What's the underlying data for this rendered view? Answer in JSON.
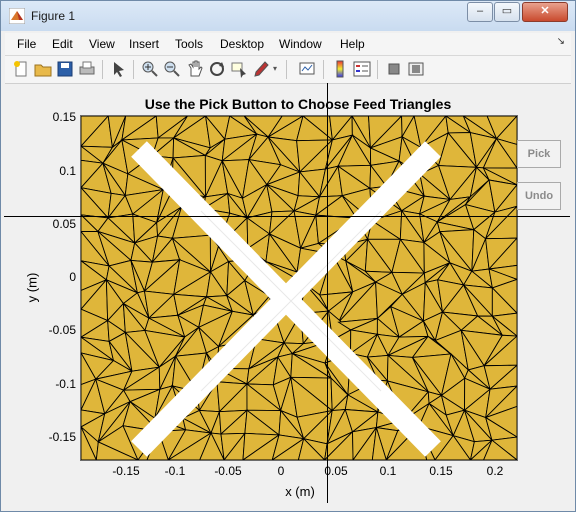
{
  "window": {
    "title": "Figure 1",
    "minimize": "–",
    "maximize": "▭",
    "close": "✕"
  },
  "menu": {
    "items": [
      "File",
      "Edit",
      "View",
      "Insert",
      "Tools",
      "Desktop",
      "Window",
      "Help"
    ],
    "overflow_glyph": "↘"
  },
  "toolbar": {
    "icons": [
      "new-figure-icon",
      "open-file-icon",
      "save-icon",
      "print-icon",
      "edit-plot-icon",
      "zoom-in-icon",
      "zoom-out-icon",
      "pan-icon",
      "rotate-3d-icon",
      "data-cursor-icon",
      "brush-icon",
      "link-plot-icon",
      "colorbar-icon",
      "legend-icon",
      "hide-plot-tools-icon",
      "show-plot-tools-icon"
    ]
  },
  "axes": {
    "title": "Use the Pick Button to Choose Feed Triangles",
    "xlabel": "x (m)",
    "ylabel": "y (m)",
    "xticks": [
      "-0.15",
      "-0.1",
      "-0.05",
      "0",
      "0.05",
      "0.1",
      "0.15",
      "0.2"
    ],
    "yticks": [
      "0.15",
      "0.1",
      "0.05",
      "0",
      "-0.05",
      "-0.1",
      "-0.15"
    ],
    "xlim": [
      -0.19,
      0.22
    ],
    "ylim": [
      -0.168,
      0.155
    ],
    "fill_color": "#dfb63a",
    "edge_color": "#000000"
  },
  "buttons": {
    "pick": "Pick",
    "undo": "Undo"
  },
  "crosshair": {
    "x": 0.043,
    "y": 0.057
  }
}
